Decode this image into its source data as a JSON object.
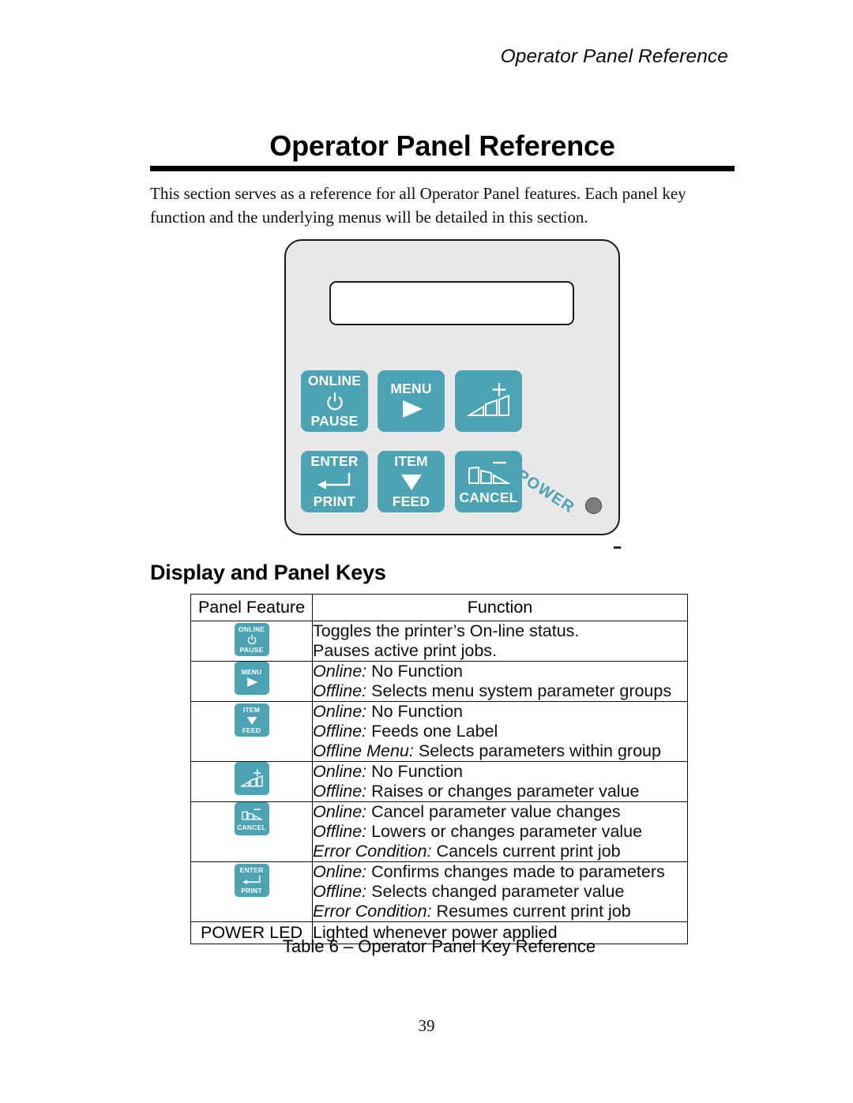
{
  "page": {
    "running_header": "Operator Panel Reference",
    "chapter_title": "Operator Panel Reference",
    "intro_line1": "This section serves as a reference for all Operator Panel features. Each panel key",
    "intro_line2": "function and the underlying menus will be detailed in this section.",
    "section_heading": "Display and Panel Keys",
    "table_caption": "Table 6 – Operator Panel Key Reference",
    "page_number": "39"
  },
  "colors": {
    "key_teal": "#4BA3B4",
    "panel_body": "#E8E8E8",
    "lcd": "#FFFFFF",
    "power_led": "#7D7D7D",
    "rule": "#000000"
  },
  "panel": {
    "power_label": "POWER",
    "keys": [
      {
        "id": "online-pause",
        "top": "ONLINE",
        "bottom": "PAUSE",
        "glyph": "power-symbol-icon"
      },
      {
        "id": "menu",
        "top": "MENU",
        "bottom": "",
        "glyph": "triangle-right-icon"
      },
      {
        "id": "plus",
        "top": "",
        "bottom": "",
        "glyph": "ascending-bars-plus-icon"
      },
      {
        "id": "enter-print",
        "top": "ENTER",
        "bottom": "PRINT",
        "glyph": "return-arrow-icon"
      },
      {
        "id": "item-feed",
        "top": "ITEM",
        "bottom": "FEED",
        "glyph": "triangle-down-icon"
      },
      {
        "id": "cancel",
        "top": "",
        "bottom": "CANCEL",
        "glyph": "descending-bars-minus-icon"
      }
    ]
  },
  "table": {
    "headers": [
      "Panel Feature",
      "Function"
    ],
    "rows": [
      {
        "key": {
          "top": "ONLINE",
          "bottom": "PAUSE",
          "glyph": "power-symbol-icon"
        },
        "lines": [
          {
            "mode": "",
            "text": "Toggles the printer’s On-line status."
          },
          {
            "mode": "",
            "text": "Pauses active print jobs."
          }
        ]
      },
      {
        "key": {
          "top": "MENU",
          "bottom": "",
          "glyph": "triangle-right-icon"
        },
        "lines": [
          {
            "mode": "Online:",
            "text": " No Function"
          },
          {
            "mode": "Offline:",
            "text": " Selects menu system parameter groups"
          }
        ]
      },
      {
        "key": {
          "top": "ITEM",
          "bottom": "FEED",
          "glyph": "triangle-down-icon"
        },
        "lines": [
          {
            "mode": "Online:",
            "text": " No Function"
          },
          {
            "mode": "Offline:",
            "text": " Feeds one Label"
          },
          {
            "mode": "Offline Menu:",
            "text": " Selects parameters within group"
          }
        ]
      },
      {
        "key": {
          "top": "",
          "bottom": "",
          "glyph": "ascending-bars-plus-icon"
        },
        "lines": [
          {
            "mode": "Online:",
            "text": " No Function"
          },
          {
            "mode": "Offline:",
            "text": " Raises or changes parameter value"
          }
        ]
      },
      {
        "key": {
          "top": "",
          "bottom": "CANCEL",
          "glyph": "descending-bars-minus-icon"
        },
        "lines": [
          {
            "mode": "Online:",
            "text": " Cancel parameter value changes"
          },
          {
            "mode": "Offline:",
            "text": " Lowers or changes parameter value"
          },
          {
            "mode": "Error Condition:",
            "text": " Cancels current print job"
          }
        ]
      },
      {
        "key": {
          "top": "ENTER",
          "bottom": "PRINT",
          "glyph": "return-arrow-icon"
        },
        "lines": [
          {
            "mode": "Online:",
            "text": " Confirms changes made to parameters"
          },
          {
            "mode": "Offline:",
            "text": " Selects changed parameter value"
          },
          {
            "mode": "Error Condition:",
            "text": " Resumes current print job"
          }
        ]
      }
    ],
    "power_led_row": {
      "label": "POWER LED",
      "function": "Lighted whenever power applied"
    }
  }
}
